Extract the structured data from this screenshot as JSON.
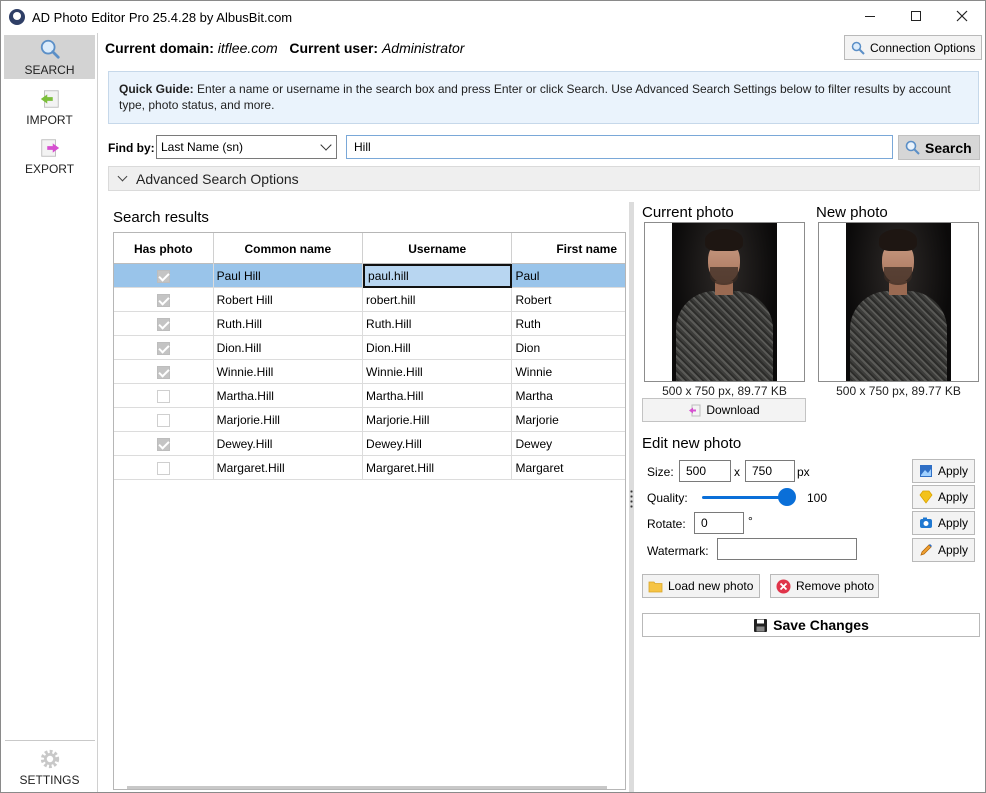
{
  "window": {
    "title": "AD Photo Editor Pro 25.4.28 by AlbusBit.com"
  },
  "nav": {
    "search": "SEARCH",
    "import": "IMPORT",
    "export": "EXPORT",
    "settings": "SETTINGS"
  },
  "header": {
    "domain_label": "Current domain:",
    "domain_value": "itflee.com",
    "user_label": "Current user:",
    "user_value": "Administrator",
    "connection_button": "Connection Options"
  },
  "guide": {
    "title": "Quick Guide:",
    "text": "Enter a name or username in the search box and press Enter or click Search. Use Advanced Search Settings below to filter results by account type, photo status, and more."
  },
  "search": {
    "findby_label": "Find by:",
    "findby_value": "Last Name (sn)",
    "query": "Hill",
    "button": "Search"
  },
  "advanced": {
    "label": "Advanced Search Options"
  },
  "results": {
    "title": "Search results",
    "columns": [
      "Has photo",
      "Common name",
      "Username",
      "First name"
    ],
    "rows": [
      {
        "has_photo": true,
        "cn": "Paul Hill",
        "user": "paul.hill",
        "first": "Paul"
      },
      {
        "has_photo": true,
        "cn": "Robert Hill",
        "user": "robert.hill",
        "first": "Robert"
      },
      {
        "has_photo": true,
        "cn": "Ruth.Hill",
        "user": "Ruth.Hill",
        "first": "Ruth"
      },
      {
        "has_photo": true,
        "cn": "Dion.Hill",
        "user": "Dion.Hill",
        "first": "Dion"
      },
      {
        "has_photo": true,
        "cn": "Winnie.Hill",
        "user": "Winnie.Hill",
        "first": "Winnie"
      },
      {
        "has_photo": false,
        "cn": "Martha.Hill",
        "user": "Martha.Hill",
        "first": "Martha"
      },
      {
        "has_photo": false,
        "cn": "Marjorie.Hill",
        "user": "Marjorie.Hill",
        "first": "Marjorie"
      },
      {
        "has_photo": true,
        "cn": "Dewey.Hill",
        "user": "Dewey.Hill",
        "first": "Dewey"
      },
      {
        "has_photo": false,
        "cn": "Margaret.Hill",
        "user": "Margaret.Hill",
        "first": "Margaret"
      }
    ]
  },
  "photos": {
    "current_label": "Current photo",
    "new_label": "New photo",
    "current_info": "500 x 750 px, 89.77 KB",
    "new_info": "500 x 750 px, 89.77 KB",
    "download": "Download"
  },
  "edit": {
    "title": "Edit new photo",
    "size_label": "Size:",
    "width": "500",
    "times": "x",
    "height": "750",
    "px": "px",
    "quality_label": "Quality:",
    "quality_value": "100",
    "rotate_label": "Rotate:",
    "rotate_value": "0",
    "degree": "°",
    "watermark_label": "Watermark:",
    "watermark_value": "",
    "apply": "Apply",
    "load": "Load new photo",
    "remove": "Remove photo",
    "save": "Save Changes"
  },
  "colors": {
    "accent": "#0a6fd8",
    "selected_row": "#99c4ea",
    "guide_bg": "#eaf3fc"
  }
}
